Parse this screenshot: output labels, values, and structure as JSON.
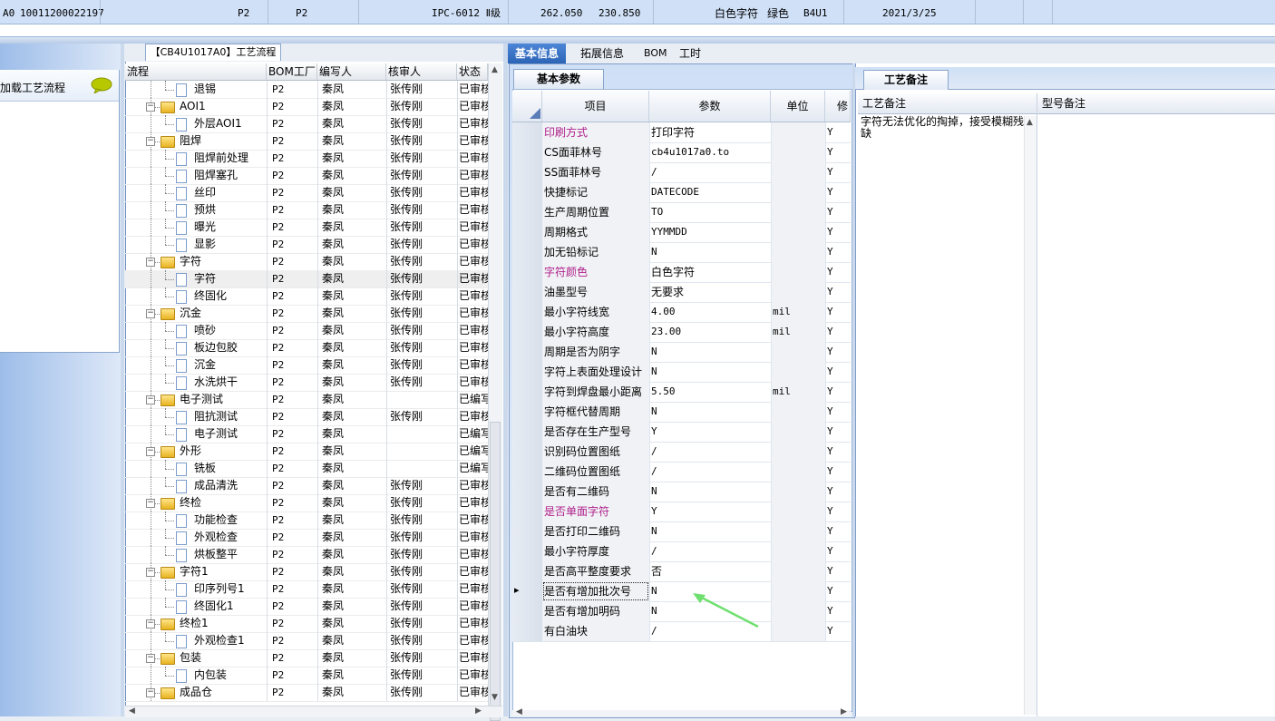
{
  "top_record": {
    "prefix": "A0",
    "code": "10011200022197",
    "factory1": "P2",
    "factory2": "P2",
    "standard": "IPC-6012 Ⅱ级",
    "length": "262.050",
    "width": "230.850",
    "char_color": "白色字符",
    "mask_color": "绿色",
    "part": "B4U1",
    "date": "2021/3/25"
  },
  "left_panel": {
    "load_label": "点加载工艺流程",
    "chat_icon": "speech-bubble-icon"
  },
  "flow": {
    "tab_title": "【CB4U1017A0】工艺流程",
    "columns": [
      "流程",
      "BOM工厂",
      "编写人",
      "核审人",
      "状态"
    ],
    "rows": [
      {
        "level": 2,
        "type": "doc",
        "name": "退锡",
        "bom": "P2",
        "writer": "秦凤",
        "reviewer": "张传刚",
        "status": "已审核"
      },
      {
        "level": 1,
        "type": "folder",
        "name": "AOI1",
        "bom": "P2",
        "writer": "秦凤",
        "reviewer": "张传刚",
        "status": "已审核"
      },
      {
        "level": 2,
        "type": "doc",
        "name": "外层AOI1",
        "bom": "P2",
        "writer": "秦凤",
        "reviewer": "张传刚",
        "status": "已审核"
      },
      {
        "level": 1,
        "type": "folder",
        "name": "阻焊",
        "bom": "P2",
        "writer": "秦凤",
        "reviewer": "张传刚",
        "status": "已审核"
      },
      {
        "level": 2,
        "type": "doc",
        "name": "阻焊前处理",
        "bom": "P2",
        "writer": "秦凤",
        "reviewer": "张传刚",
        "status": "已审核"
      },
      {
        "level": 2,
        "type": "doc",
        "name": "阻焊塞孔",
        "bom": "P2",
        "writer": "秦凤",
        "reviewer": "张传刚",
        "status": "已审核"
      },
      {
        "level": 2,
        "type": "doc",
        "name": "丝印",
        "bom": "P2",
        "writer": "秦凤",
        "reviewer": "张传刚",
        "status": "已审核"
      },
      {
        "level": 2,
        "type": "doc",
        "name": "预烘",
        "bom": "P2",
        "writer": "秦凤",
        "reviewer": "张传刚",
        "status": "已审核"
      },
      {
        "level": 2,
        "type": "doc",
        "name": "曝光",
        "bom": "P2",
        "writer": "秦凤",
        "reviewer": "张传刚",
        "status": "已审核"
      },
      {
        "level": 2,
        "type": "doc",
        "name": "显影",
        "bom": "P2",
        "writer": "秦凤",
        "reviewer": "张传刚",
        "status": "已审核"
      },
      {
        "level": 1,
        "type": "folder",
        "name": "字符",
        "bom": "P2",
        "writer": "秦凤",
        "reviewer": "张传刚",
        "status": "已审核"
      },
      {
        "level": 2,
        "type": "doc",
        "name": "字符",
        "bom": "P2",
        "writer": "秦凤",
        "reviewer": "张传刚",
        "status": "已审核",
        "selected": true
      },
      {
        "level": 2,
        "type": "doc",
        "name": "终固化",
        "bom": "P2",
        "writer": "秦凤",
        "reviewer": "张传刚",
        "status": "已审核"
      },
      {
        "level": 1,
        "type": "folder",
        "name": "沉金",
        "bom": "P2",
        "writer": "秦凤",
        "reviewer": "张传刚",
        "status": "已审核"
      },
      {
        "level": 2,
        "type": "doc",
        "name": "喷砂",
        "bom": "P2",
        "writer": "秦凤",
        "reviewer": "张传刚",
        "status": "已审核"
      },
      {
        "level": 2,
        "type": "doc",
        "name": "板边包胶",
        "bom": "P2",
        "writer": "秦凤",
        "reviewer": "张传刚",
        "status": "已审核"
      },
      {
        "level": 2,
        "type": "doc",
        "name": "沉金",
        "bom": "P2",
        "writer": "秦凤",
        "reviewer": "张传刚",
        "status": "已审核"
      },
      {
        "level": 2,
        "type": "doc",
        "name": "水洗烘干",
        "bom": "P2",
        "writer": "秦凤",
        "reviewer": "张传刚",
        "status": "已审核"
      },
      {
        "level": 1,
        "type": "folder",
        "name": "电子测试",
        "bom": "P2",
        "writer": "秦凤",
        "reviewer": "",
        "status": "已编写"
      },
      {
        "level": 2,
        "type": "doc",
        "name": "阻抗测试",
        "bom": "P2",
        "writer": "秦凤",
        "reviewer": "张传刚",
        "status": "已审核"
      },
      {
        "level": 2,
        "type": "doc",
        "name": "电子测试",
        "bom": "P2",
        "writer": "秦凤",
        "reviewer": "",
        "status": "已编写"
      },
      {
        "level": 1,
        "type": "folder",
        "name": "外形",
        "bom": "P2",
        "writer": "秦凤",
        "reviewer": "",
        "status": "已编写"
      },
      {
        "level": 2,
        "type": "doc",
        "name": "铣板",
        "bom": "P2",
        "writer": "秦凤",
        "reviewer": "",
        "status": "已编写"
      },
      {
        "level": 2,
        "type": "doc",
        "name": "成品清洗",
        "bom": "P2",
        "writer": "秦凤",
        "reviewer": "张传刚",
        "status": "已审核"
      },
      {
        "level": 1,
        "type": "folder",
        "name": "终检",
        "bom": "P2",
        "writer": "秦凤",
        "reviewer": "张传刚",
        "status": "已审核"
      },
      {
        "level": 2,
        "type": "doc",
        "name": "功能检查",
        "bom": "P2",
        "writer": "秦凤",
        "reviewer": "张传刚",
        "status": "已审核"
      },
      {
        "level": 2,
        "type": "doc",
        "name": "外观检查",
        "bom": "P2",
        "writer": "秦凤",
        "reviewer": "张传刚",
        "status": "已审核"
      },
      {
        "level": 2,
        "type": "doc",
        "name": "烘板整平",
        "bom": "P2",
        "writer": "秦凤",
        "reviewer": "张传刚",
        "status": "已审核"
      },
      {
        "level": 1,
        "type": "folder",
        "name": "字符1",
        "bom": "P2",
        "writer": "秦凤",
        "reviewer": "张传刚",
        "status": "已审核"
      },
      {
        "level": 2,
        "type": "doc",
        "name": "印序列号1",
        "bom": "P2",
        "writer": "秦凤",
        "reviewer": "张传刚",
        "status": "已审核"
      },
      {
        "level": 2,
        "type": "doc",
        "name": "终固化1",
        "bom": "P2",
        "writer": "秦凤",
        "reviewer": "张传刚",
        "status": "已审核"
      },
      {
        "level": 1,
        "type": "folder",
        "name": "终检1",
        "bom": "P2",
        "writer": "秦凤",
        "reviewer": "张传刚",
        "status": "已审核"
      },
      {
        "level": 2,
        "type": "doc",
        "name": "外观检查1",
        "bom": "P2",
        "writer": "秦凤",
        "reviewer": "张传刚",
        "status": "已审核"
      },
      {
        "level": 1,
        "type": "folder",
        "name": "包装",
        "bom": "P2",
        "writer": "秦凤",
        "reviewer": "张传刚",
        "status": "已审核"
      },
      {
        "level": 2,
        "type": "doc",
        "name": "内包装",
        "bom": "P2",
        "writer": "秦凤",
        "reviewer": "张传刚",
        "status": "已审核"
      },
      {
        "level": 1,
        "type": "folder",
        "name": "成品仓",
        "bom": "P2",
        "writer": "秦凤",
        "reviewer": "张传刚",
        "status": "已审核"
      }
    ]
  },
  "main": {
    "tabs": [
      "基本信息",
      "拓展信息",
      "BOM",
      "工时"
    ],
    "active_tab": "基本信息",
    "subtab": "基本参数",
    "columns": [
      "项目",
      "参数",
      "单位",
      "修"
    ],
    "rows": [
      {
        "item": "印刷方式",
        "value": "打印字符",
        "unit": "",
        "flag": "Y",
        "highlight": true
      },
      {
        "item": "CS面菲林号",
        "value": "cb4u1017a0.to",
        "unit": "",
        "flag": "Y"
      },
      {
        "item": "SS面菲林号",
        "value": "/",
        "unit": "",
        "flag": "Y"
      },
      {
        "item": "快捷标记",
        "value": "DATECODE",
        "unit": "",
        "flag": "Y"
      },
      {
        "item": "生产周期位置",
        "value": "TO",
        "unit": "",
        "flag": "Y"
      },
      {
        "item": "周期格式",
        "value": "YYMMDD",
        "unit": "",
        "flag": "Y"
      },
      {
        "item": "加无铅标记",
        "value": "N",
        "unit": "",
        "flag": "Y"
      },
      {
        "item": "字符颜色",
        "value": "白色字符",
        "unit": "",
        "flag": "Y",
        "highlight": true
      },
      {
        "item": "油墨型号",
        "value": "无要求",
        "unit": "",
        "flag": "Y"
      },
      {
        "item": "最小字符线宽",
        "value": "4.00",
        "unit": "mil",
        "flag": "Y"
      },
      {
        "item": "最小字符高度",
        "value": "23.00",
        "unit": "mil",
        "flag": "Y"
      },
      {
        "item": "周期是否为阴字",
        "value": "N",
        "unit": "",
        "flag": "Y"
      },
      {
        "item": "字符上表面处理设计",
        "value": "N",
        "unit": "",
        "flag": "Y"
      },
      {
        "item": "字符到焊盘最小距离",
        "value": "5.50",
        "unit": "mil",
        "flag": "Y"
      },
      {
        "item": "字符框代替周期",
        "value": "N",
        "unit": "",
        "flag": "Y"
      },
      {
        "item": "是否存在生产型号",
        "value": "Y",
        "unit": "",
        "flag": "Y"
      },
      {
        "item": "识别码位置图纸",
        "value": "/",
        "unit": "",
        "flag": "Y"
      },
      {
        "item": "二维码位置图纸",
        "value": "/",
        "unit": "",
        "flag": "Y"
      },
      {
        "item": "是否有二维码",
        "value": "N",
        "unit": "",
        "flag": "Y"
      },
      {
        "item": "是否单面字符",
        "value": "Y",
        "unit": "",
        "flag": "Y",
        "highlight": true
      },
      {
        "item": "是否打印二维码",
        "value": "N",
        "unit": "",
        "flag": "Y"
      },
      {
        "item": "最小字符厚度",
        "value": "/",
        "unit": "",
        "flag": "Y"
      },
      {
        "item": "是否高平整度要求",
        "value": "否",
        "unit": "",
        "flag": "Y"
      },
      {
        "item": "是否有增加批次号",
        "value": "N",
        "unit": "",
        "flag": "Y",
        "current": true
      },
      {
        "item": "是否有增加明码",
        "value": "N",
        "unit": "",
        "flag": "Y"
      },
      {
        "item": "有白油块",
        "value": "/",
        "unit": "",
        "flag": "Y"
      }
    ]
  },
  "right": {
    "tab": "工艺备注",
    "columns": [
      "工艺备注",
      "型号备注"
    ],
    "remark": "字符无法优化的掏掉，接受模糊残缺"
  },
  "colors": {
    "highlight_item": "#b0208c",
    "active_tab": "#2c64b6",
    "arrow": "#6fe06f"
  }
}
